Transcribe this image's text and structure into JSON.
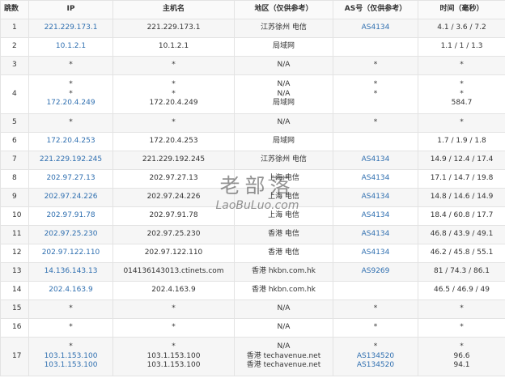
{
  "headers": [
    "跳数",
    "IP",
    "主机名",
    "地区（仅供参考）",
    "AS号（仅供参考）",
    "时间（毫秒）"
  ],
  "rows": [
    {
      "hop": "1",
      "lines": [
        {
          "ip": "221.229.173.1",
          "host": "221.229.173.1",
          "region": "江苏徐州 电信",
          "as": "AS4134",
          "time": "4.1 / 3.6 / 7.2"
        }
      ]
    },
    {
      "hop": "2",
      "lines": [
        {
          "ip": "10.1.2.1",
          "host": "10.1.2.1",
          "region": "局域网",
          "as": "",
          "time": "1.1 / 1 / 1.3"
        }
      ]
    },
    {
      "hop": "3",
      "lines": [
        {
          "ip": "*",
          "host": "*",
          "region": "N/A",
          "as": "*",
          "time": "*"
        }
      ]
    },
    {
      "hop": "4",
      "lines": [
        {
          "ip": "*",
          "host": "*",
          "region": "N/A",
          "as": "*",
          "time": "*"
        },
        {
          "ip": "*",
          "host": "*",
          "region": "N/A",
          "as": "*",
          "time": "*"
        },
        {
          "ip": "172.20.4.249",
          "host": "172.20.4.249",
          "region": "局域网",
          "as": "",
          "time": "584.7"
        }
      ]
    },
    {
      "hop": "5",
      "lines": [
        {
          "ip": "*",
          "host": "*",
          "region": "N/A",
          "as": "*",
          "time": "*"
        }
      ]
    },
    {
      "hop": "6",
      "lines": [
        {
          "ip": "172.20.4.253",
          "host": "172.20.4.253",
          "region": "局域网",
          "as": "",
          "time": "1.7 / 1.9 / 1.8"
        }
      ]
    },
    {
      "hop": "7",
      "lines": [
        {
          "ip": "221.229.192.245",
          "host": "221.229.192.245",
          "region": "江苏徐州 电信",
          "as": "AS4134",
          "time": "14.9 / 12.4 / 17.4"
        }
      ]
    },
    {
      "hop": "8",
      "lines": [
        {
          "ip": "202.97.27.13",
          "host": "202.97.27.13",
          "region": "上海 电信",
          "as": "AS4134",
          "time": "17.1 / 14.7 / 19.8"
        }
      ]
    },
    {
      "hop": "9",
      "lines": [
        {
          "ip": "202.97.24.226",
          "host": "202.97.24.226",
          "region": "上海 电信",
          "as": "AS4134",
          "time": "14.8 / 14.6 / 14.9"
        }
      ]
    },
    {
      "hop": "10",
      "lines": [
        {
          "ip": "202.97.91.78",
          "host": "202.97.91.78",
          "region": "上海 电信",
          "as": "AS4134",
          "time": "18.4 / 60.8 / 17.7"
        }
      ]
    },
    {
      "hop": "11",
      "lines": [
        {
          "ip": "202.97.25.230",
          "host": "202.97.25.230",
          "region": "香港 电信",
          "as": "AS4134",
          "time": "46.8 / 43.9 / 49.1"
        }
      ]
    },
    {
      "hop": "12",
      "lines": [
        {
          "ip": "202.97.122.110",
          "host": "202.97.122.110",
          "region": "香港 电信",
          "as": "AS4134",
          "time": "46.2 / 45.8 / 55.1"
        }
      ]
    },
    {
      "hop": "13",
      "lines": [
        {
          "ip": "14.136.143.13",
          "host": "014136143013.ctinets.com",
          "region": "香港 hkbn.com.hk",
          "as": "AS9269",
          "time": "81 / 74.3 / 86.1"
        }
      ]
    },
    {
      "hop": "14",
      "lines": [
        {
          "ip": "202.4.163.9",
          "host": "202.4.163.9",
          "region": "香港 hkbn.com.hk",
          "as": "",
          "time": "46.5 / 46.9 / 49"
        }
      ]
    },
    {
      "hop": "15",
      "lines": [
        {
          "ip": "*",
          "host": "*",
          "region": "N/A",
          "as": "*",
          "time": "*"
        }
      ]
    },
    {
      "hop": "16",
      "lines": [
        {
          "ip": "*",
          "host": "*",
          "region": "N/A",
          "as": "*",
          "time": "*"
        }
      ]
    },
    {
      "hop": "17",
      "lines": [
        {
          "ip": "*",
          "host": "*",
          "region": "N/A",
          "as": "*",
          "time": "*"
        },
        {
          "ip": "103.1.153.100",
          "host": "103.1.153.100",
          "region": "香港 techavenue.net",
          "as": "AS134520",
          "time": "96.6"
        },
        {
          "ip": "103.1.153.100",
          "host": "103.1.153.100",
          "region": "香港 techavenue.net",
          "as": "AS134520",
          "time": "94.1"
        }
      ]
    }
  ],
  "watermark": {
    "cn": "老部落",
    "en": "LaoBuLuo.com"
  },
  "colors": {
    "link": "#2f6fb0",
    "border": "#e3e3e3",
    "shade": "#f6f6f6"
  }
}
